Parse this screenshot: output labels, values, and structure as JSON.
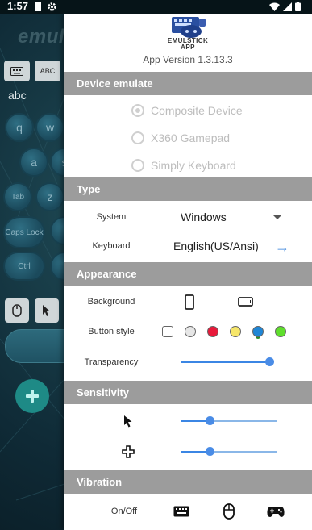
{
  "status_bar": {
    "time": "1:57"
  },
  "background_app": {
    "watermark": "emulst",
    "abc_button": "ABC",
    "text_field_value": "abc",
    "keys": [
      "q",
      "w",
      "a",
      "s",
      "z",
      "Tab",
      "Caps Lock",
      "Ctrl"
    ]
  },
  "panel": {
    "logo_text_line1": "EMULSTICK",
    "logo_text_line2": "APP",
    "version": "App Version 1.3.13.3",
    "device_section": "Device emulate",
    "device_options": [
      {
        "label": "Composite Device",
        "checked": true
      },
      {
        "label": "X360 Gamepad",
        "checked": false
      },
      {
        "label": "Simply Keyboard",
        "checked": false
      }
    ],
    "type_section": "Type",
    "system_label": "System",
    "system_value": "Windows",
    "keyboard_label": "Keyboard",
    "keyboard_value": "English(US/Ansi)",
    "appearance_section": "Appearance",
    "background_label": "Background",
    "button_style_label": "Button style",
    "button_styles": [
      {
        "color": "#ffffff",
        "shape": "square"
      },
      {
        "color": "#e6e6e6",
        "shape": "circle"
      },
      {
        "color": "#e8193a",
        "shape": "circle"
      },
      {
        "color": "#f6e66a",
        "shape": "circle"
      },
      {
        "color": "#1f86d6",
        "shape": "circle",
        "selected": true
      },
      {
        "color": "#5fde2c",
        "shape": "circle"
      }
    ],
    "transparency_label": "Transparency",
    "transparency_level": 0.98,
    "sensitivity_section": "Sensitivity",
    "pointer_sensitivity": 0.3,
    "dpad_sensitivity": 0.3,
    "vibration_section": "Vibration",
    "onoff_label": "On/Off"
  }
}
